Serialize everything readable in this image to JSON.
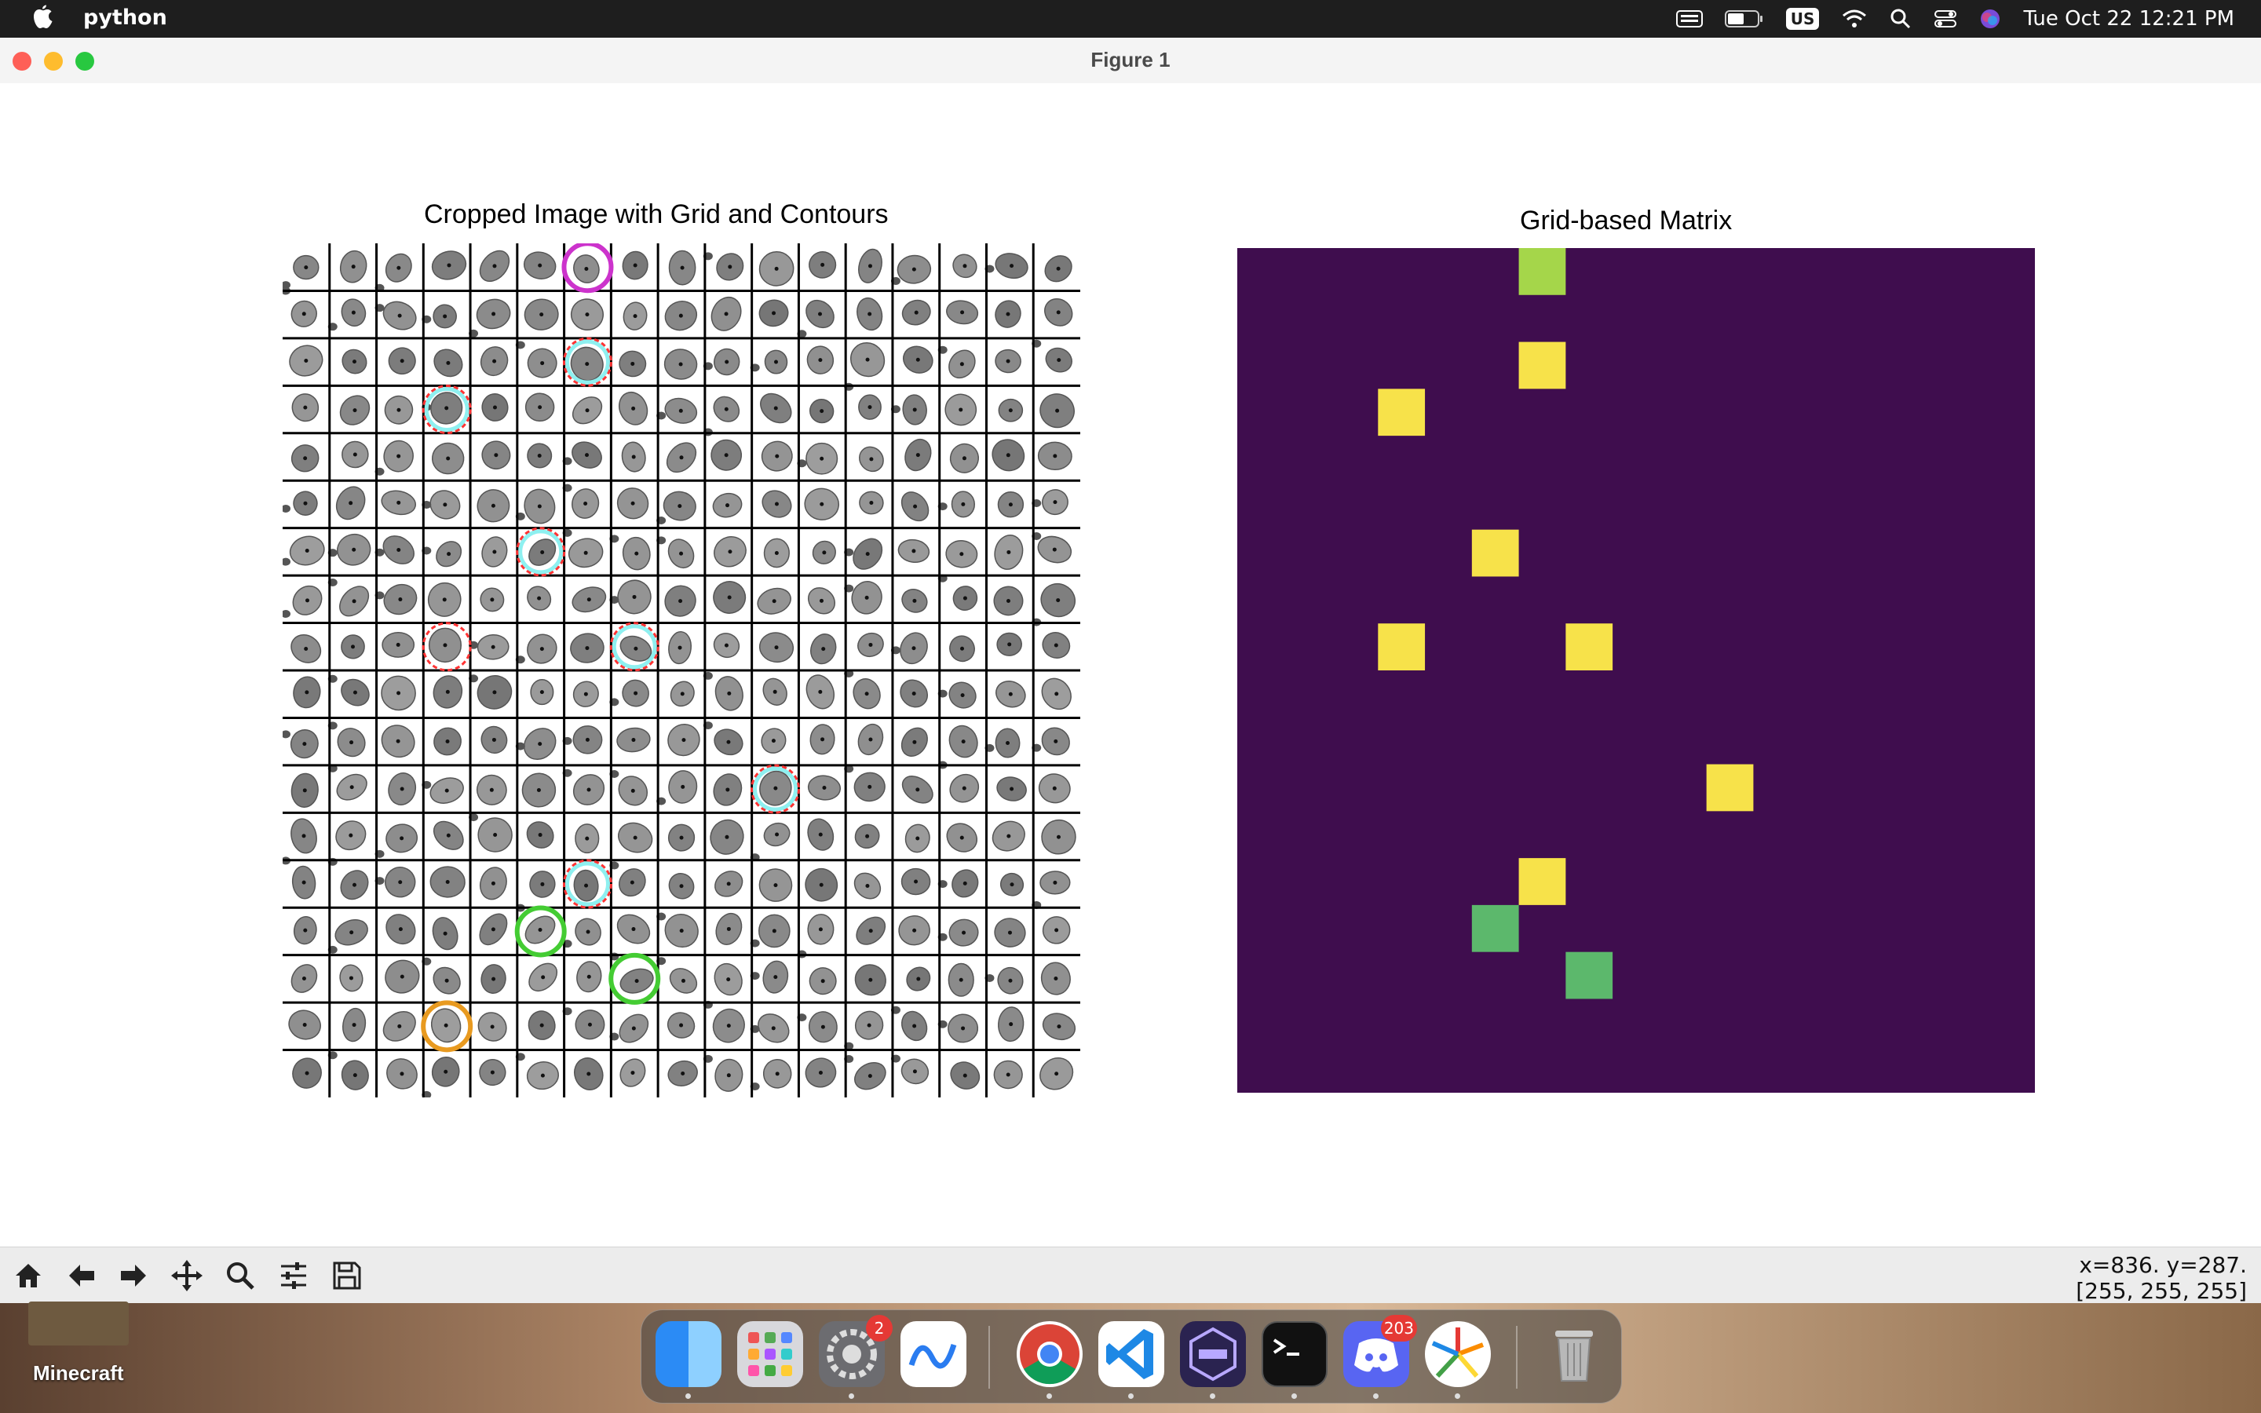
{
  "menubar": {
    "app_name": "python",
    "keyboard_layout": "US",
    "datetime": "Tue Oct 22  12:21 PM"
  },
  "window": {
    "title": "Figure 1"
  },
  "left_plot": {
    "title": "Cropped Image with Grid and Contours",
    "grid_rows": 18,
    "grid_cols": 17,
    "circles": [
      {
        "row": 0,
        "col": 6,
        "color": "#cc33cc",
        "style": "solid"
      },
      {
        "row": 2,
        "col": 6,
        "color": "#ff3333",
        "style": "dashed-cyan"
      },
      {
        "row": 3,
        "col": 3,
        "color": "#ff3333",
        "style": "dashed-cyan"
      },
      {
        "row": 6,
        "col": 5,
        "color": "#ff3333",
        "style": "dashed-cyan"
      },
      {
        "row": 8,
        "col": 3,
        "color": "#ff3333",
        "style": "dashed"
      },
      {
        "row": 8,
        "col": 7,
        "color": "#ff3333",
        "style": "dashed-cyan"
      },
      {
        "row": 11,
        "col": 10,
        "color": "#ff3333",
        "style": "dashed-cyan"
      },
      {
        "row": 13,
        "col": 6,
        "color": "#ff3333",
        "style": "dashed-cyan"
      },
      {
        "row": 14,
        "col": 5,
        "color": "#44cc33",
        "style": "solid"
      },
      {
        "row": 15,
        "col": 7,
        "color": "#44cc33",
        "style": "solid"
      },
      {
        "row": 16,
        "col": 3,
        "color": "#e89a20",
        "style": "solid"
      }
    ]
  },
  "right_plot": {
    "title": "Grid-based Matrix",
    "background_color": "#3f0d4e",
    "cells": [
      {
        "row": 0,
        "col": 6,
        "color": "#a5d64a"
      },
      {
        "row": 2,
        "col": 6,
        "color": "#f7e24a"
      },
      {
        "row": 3,
        "col": 3,
        "color": "#f7e24a"
      },
      {
        "row": 6,
        "col": 5,
        "color": "#f7e24a"
      },
      {
        "row": 8,
        "col": 3,
        "color": "#f7e24a"
      },
      {
        "row": 8,
        "col": 7,
        "color": "#f7e24a"
      },
      {
        "row": 11,
        "col": 10,
        "color": "#f7e24a"
      },
      {
        "row": 13,
        "col": 6,
        "color": "#f7e24a"
      },
      {
        "row": 14,
        "col": 5,
        "color": "#5cb86c"
      },
      {
        "row": 15,
        "col": 7,
        "color": "#5cb86c"
      }
    ]
  },
  "toolbar": {
    "buttons": [
      "home-icon",
      "back-icon",
      "forward-icon",
      "pan-icon",
      "zoom-icon",
      "configure-icon",
      "save-icon"
    ],
    "coords_line1": "x=836. y=287.",
    "coords_line2": "[255, 255, 255]"
  },
  "desktop": {
    "icon_label": "Minecraft"
  },
  "dock": {
    "apps": [
      {
        "name": "finder",
        "badge": ""
      },
      {
        "name": "launchpad",
        "badge": ""
      },
      {
        "name": "system-settings",
        "badge": "2"
      },
      {
        "name": "freeform",
        "badge": ""
      },
      {
        "name": "chrome",
        "badge": ""
      },
      {
        "name": "vscode",
        "badge": ""
      },
      {
        "name": "simulator",
        "badge": ""
      },
      {
        "name": "terminal",
        "badge": ""
      },
      {
        "name": "discord",
        "badge": "203"
      },
      {
        "name": "pinwheel-app",
        "badge": ""
      },
      {
        "name": "trash",
        "badge": ""
      }
    ]
  }
}
